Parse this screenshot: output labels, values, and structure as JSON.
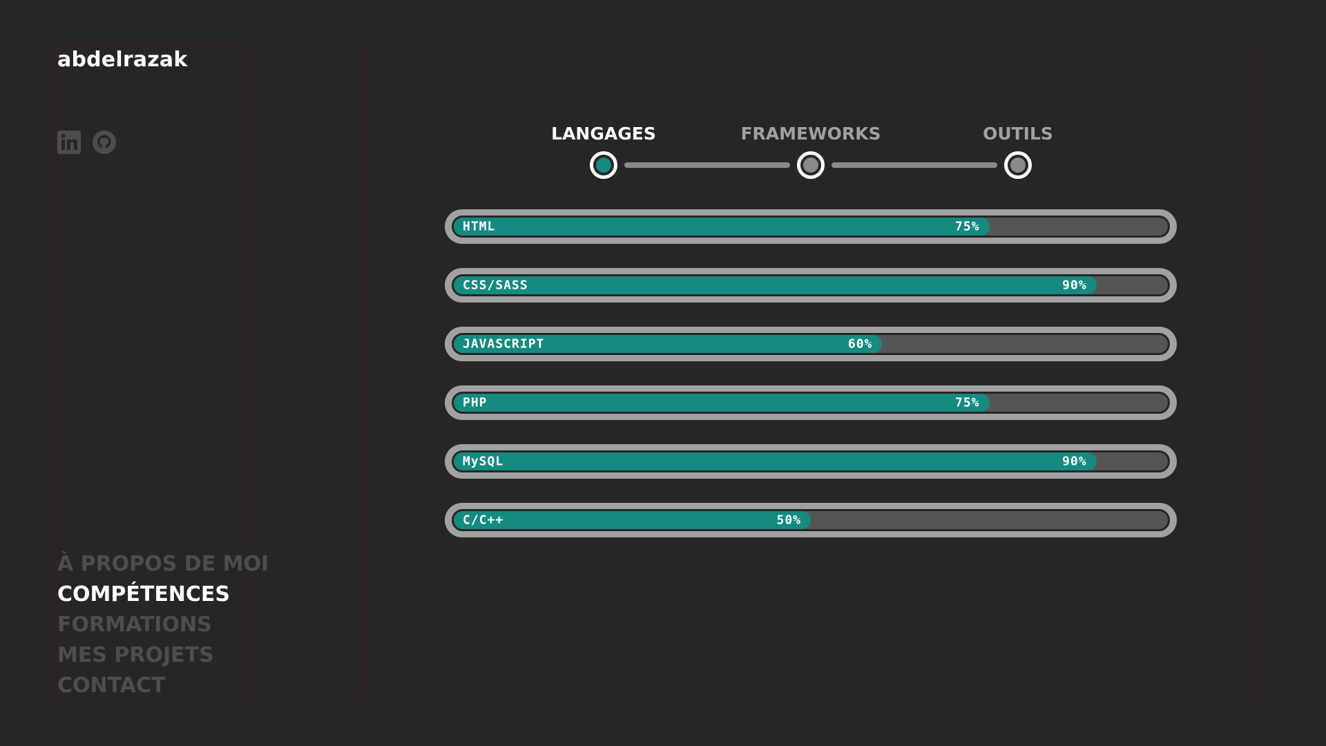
{
  "brand": {
    "name": "abdelrazak"
  },
  "socials": [
    {
      "icon": "linkedin-icon"
    },
    {
      "icon": "github-icon"
    }
  ],
  "nav": {
    "items": [
      {
        "label": "À PROPOS DE MOI",
        "active": false
      },
      {
        "label": "COMPÉTENCES",
        "active": true
      },
      {
        "label": "FORMATIONS",
        "active": false
      },
      {
        "label": "MES PROJETS",
        "active": false
      },
      {
        "label": "CONTACT",
        "active": false
      }
    ]
  },
  "stepper": {
    "steps": [
      {
        "label": "LANGAGES",
        "active": true
      },
      {
        "label": "FRAMEWORKS",
        "active": false
      },
      {
        "label": "OUTILS",
        "active": false
      }
    ]
  },
  "skills": [
    {
      "name": "HTML",
      "percent": "75%",
      "level": 0.75
    },
    {
      "name": "CSS/SASS",
      "percent": "90%",
      "level": 0.9
    },
    {
      "name": "JAVASCRIPT",
      "percent": "60%",
      "level": 0.6
    },
    {
      "name": "PHP",
      "percent": "75%",
      "level": 0.75
    },
    {
      "name": "MySQL",
      "percent": "90%",
      "level": 0.9
    },
    {
      "name": "C/C++",
      "percent": "50%",
      "level": 0.5
    }
  ],
  "colors": {
    "background": "#262626",
    "accent": "#158a80",
    "muted": "#4d4d4d",
    "bar_frame": "#a1a1a1",
    "bar_track": "#555555"
  }
}
